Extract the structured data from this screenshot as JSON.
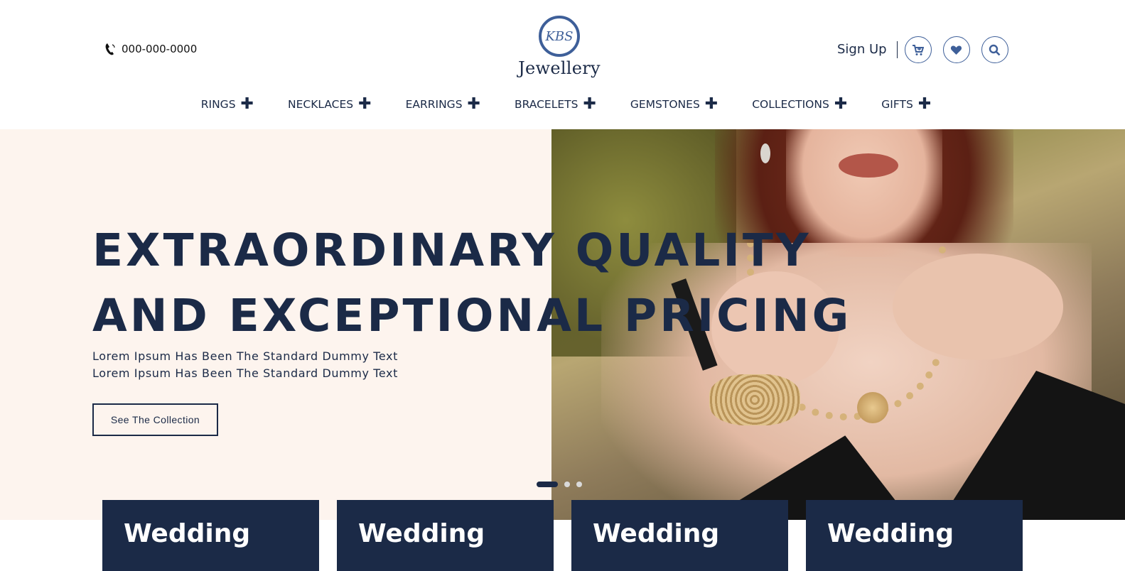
{
  "header": {
    "phone": "000-000-0000",
    "logo_mark": "KBS",
    "logo_word": "Jewellery",
    "signup": "Sign Up",
    "icons": [
      "phone-icon",
      "cart-icon",
      "heart-icon",
      "search-icon"
    ]
  },
  "nav": {
    "items": [
      {
        "label": "RINGS"
      },
      {
        "label": "NECKLACES"
      },
      {
        "label": "EARRINGS"
      },
      {
        "label": "BRACELETS"
      },
      {
        "label": "GEMSTONES"
      },
      {
        "label": "COLLECTIONS"
      },
      {
        "label": "GIFTS"
      }
    ],
    "expand_symbol": "✚"
  },
  "hero": {
    "title_line1": "EXTRAORDINARY QUALITY",
    "title_line2": "AND EXCEPTIONAL PRICING",
    "subtitle": "Lorem Ipsum Has Been The Standard Dummy Text Lorem Ipsum Has Been The Standard Dummy Text",
    "button": "See The Collection",
    "slides_total": 3,
    "active_slide": 1
  },
  "cards": [
    {
      "title": "Wedding"
    },
    {
      "title": "Wedding"
    },
    {
      "title": "Wedding"
    },
    {
      "title": "Wedding"
    }
  ],
  "colors": {
    "navy": "#1b2a47",
    "accent_blue": "#3e5f99",
    "hero_bg": "#fdf4ee"
  }
}
